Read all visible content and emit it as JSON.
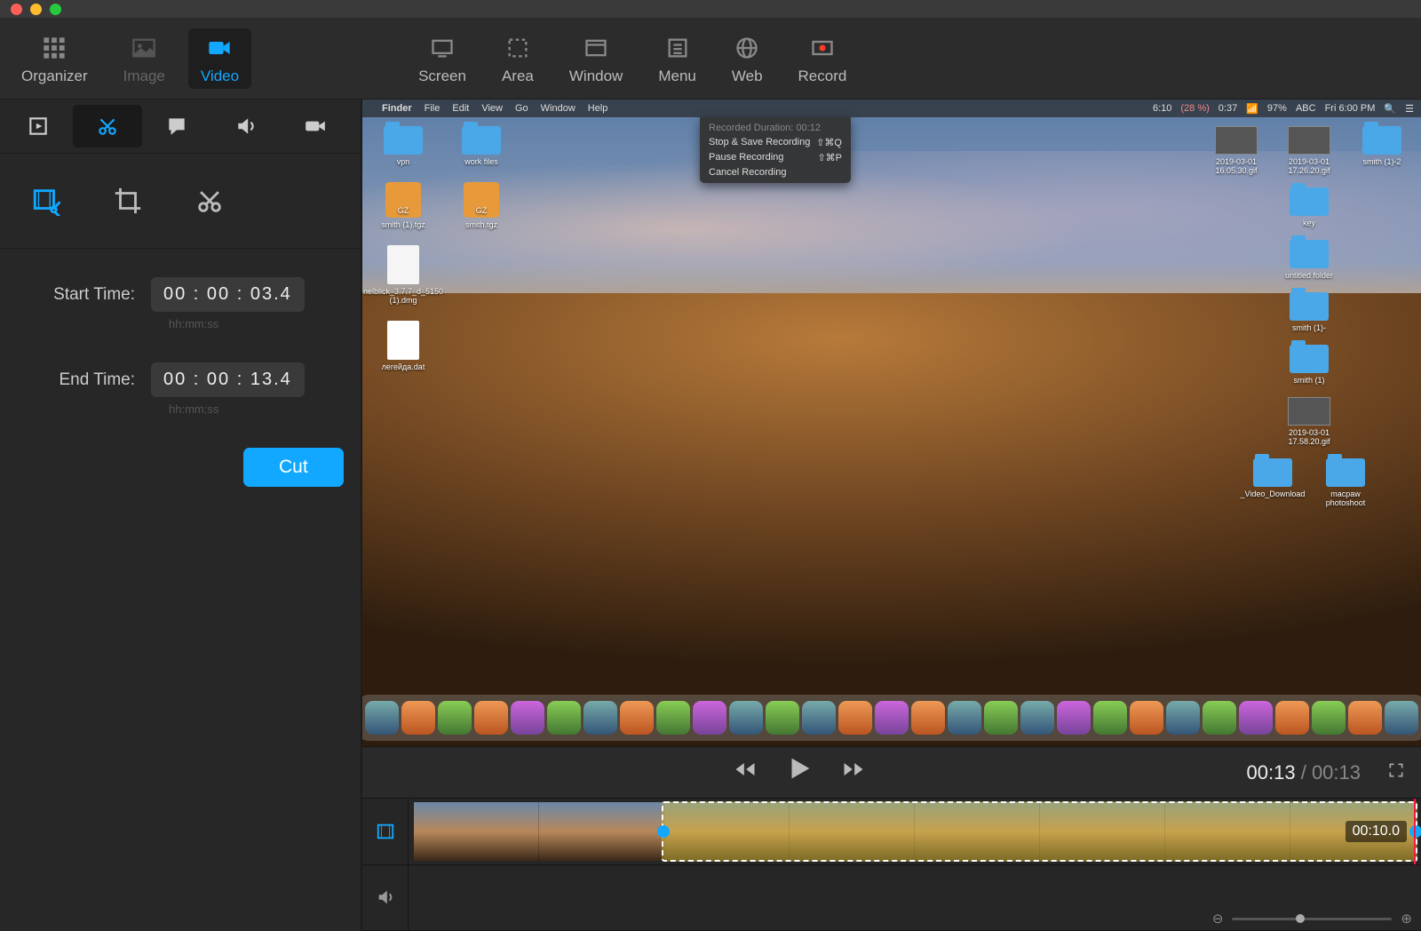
{
  "traffic": {
    "close": "close",
    "min": "minimize",
    "max": "maximize"
  },
  "toolbar": {
    "organizer": "Organizer",
    "image": "Image",
    "video": "Video",
    "screen": "Screen",
    "area": "Area",
    "window": "Window",
    "menu": "Menu",
    "web": "Web",
    "record": "Record"
  },
  "side_tools": {
    "clips": "clips",
    "trim": "trim",
    "annotate": "callout",
    "audio": "audio",
    "camera": "camera"
  },
  "edit_tools": {
    "cut_frames": "cut-frames",
    "crop": "crop",
    "scissors": "scissors"
  },
  "cut": {
    "start_label": "Start Time:",
    "start_value": "00  :  00  : 03.4",
    "end_label": "End Time:",
    "end_value": "00  :  00  : 13.4",
    "hint": "hh:mm:ss",
    "button": "Cut"
  },
  "desktop": {
    "menubar_app": "Finder",
    "menus": [
      "File",
      "Edit",
      "View",
      "Go",
      "Window",
      "Help"
    ],
    "status_right": [
      "6:10",
      "(28 %)",
      "0:37",
      "97%",
      "ABC",
      "Fri 6:00 PM"
    ],
    "dropdown": {
      "header": "Recorded Duration: 00:12",
      "items": [
        {
          "label": "Stop & Save Recording",
          "shortcut": "⇧⌘Q"
        },
        {
          "label": "Pause Recording",
          "shortcut": "⇧⌘P"
        },
        {
          "label": "Cancel Recording",
          "shortcut": ""
        }
      ]
    },
    "left_icons": [
      {
        "type": "folder",
        "label": "vpn"
      },
      {
        "type": "folder",
        "label": "work files"
      },
      {
        "type": "gz",
        "label": "smith (1).tgz"
      },
      {
        "type": "gz",
        "label": "smith.tgz"
      },
      {
        "type": "doc",
        "label": "nelblick_3.7.7_d_5150 (1).dmg"
      },
      {
        "type": "doc",
        "label": "легейда.dat"
      }
    ],
    "right_icons": [
      {
        "type": "thumb",
        "label": "2019-03-01 16.05.30.gif"
      },
      {
        "type": "thumb",
        "label": "2019-03-01 17.26.20.gif"
      },
      {
        "type": "folder",
        "label": "smith (1)-2"
      },
      {
        "type": "folder",
        "label": "key"
      },
      {
        "type": "folder",
        "label": "untitled folder"
      },
      {
        "type": "folder",
        "label": "smith (1)-"
      },
      {
        "type": "folder",
        "label": "smith (1)"
      },
      {
        "type": "thumb",
        "label": "2019-03-01 17.58.20.gif"
      },
      {
        "type": "folder",
        "label": "_Video_Download"
      },
      {
        "type": "folder",
        "label": "macpaw photoshoot"
      }
    ]
  },
  "playback": {
    "current": "00:13",
    "total": "00:13"
  },
  "timeline": {
    "selection_time": "00:10.0"
  }
}
